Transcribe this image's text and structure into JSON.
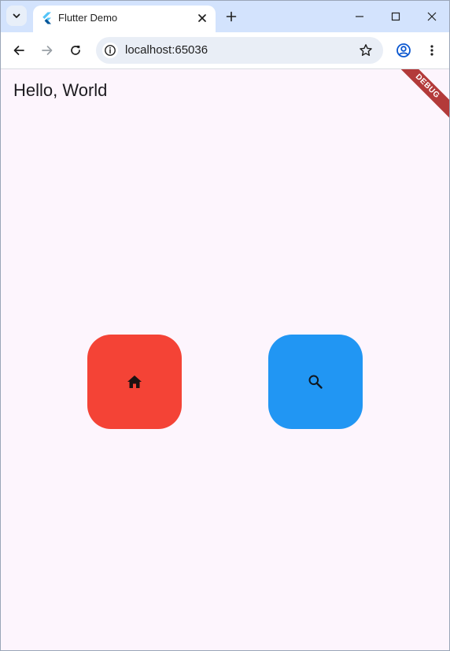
{
  "browser": {
    "tab_title": "Flutter Demo",
    "url": "localhost:65036",
    "icons": {
      "tab_search": "chevron-down-icon",
      "favicon": "flutter-logo-icon",
      "tab_close": "close-icon",
      "new_tab": "plus-icon",
      "minimize": "minimize-icon",
      "maximize": "maximize-icon",
      "window_close": "close-icon",
      "back": "arrow-left-icon",
      "forward": "arrow-right-icon",
      "reload": "reload-icon",
      "site_info": "info-icon",
      "bookmark": "star-icon",
      "profile": "account-circle-icon",
      "menu": "more-vert-icon"
    }
  },
  "app": {
    "greeting": "Hello, World",
    "debug_banner": "DEBUG",
    "background": "#fdf5fd",
    "tiles": [
      {
        "name": "home",
        "icon": "home-icon",
        "color": "#f44336"
      },
      {
        "name": "search",
        "icon": "search-icon",
        "color": "#2196f3"
      }
    ]
  }
}
